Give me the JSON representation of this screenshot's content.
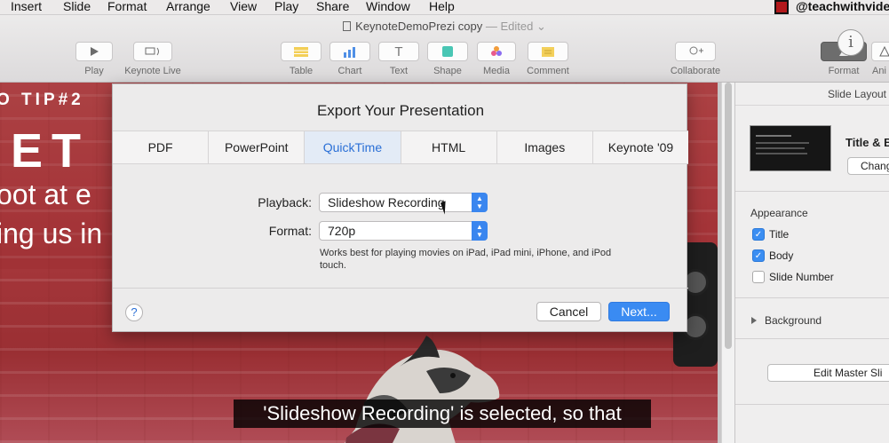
{
  "menubar": {
    "items": [
      "Insert",
      "Slide",
      "Format",
      "Arrange",
      "View",
      "Play",
      "Share",
      "Window",
      "Help"
    ],
    "account_handle": "@teachwithvide"
  },
  "window": {
    "doc_title": "KeynoteDemoPrezi copy",
    "edited_label": "— Edited ⌄"
  },
  "toolbar": {
    "buttons": [
      {
        "label": "Play",
        "icon": "play-icon"
      },
      {
        "label": "Keynote Live",
        "icon": "keynote-live-icon"
      },
      {
        "label": "Table",
        "icon": "table-icon"
      },
      {
        "label": "Chart",
        "icon": "chart-icon"
      },
      {
        "label": "Text",
        "icon": "text-icon"
      },
      {
        "label": "Shape",
        "icon": "shape-icon"
      },
      {
        "label": "Media",
        "icon": "media-icon"
      },
      {
        "label": "Comment",
        "icon": "comment-icon"
      },
      {
        "label": "Collaborate",
        "icon": "collaborate-icon"
      },
      {
        "label": "Format",
        "icon": "format-brush-icon"
      },
      {
        "label": "Ani",
        "icon": "animate-icon"
      }
    ],
    "info_glyph": "i"
  },
  "slide": {
    "tip_text": "O TIP#2",
    "big_text": "ET",
    "line1": "oot at e",
    "line2": "ing us in"
  },
  "inspector": {
    "header": "Slide Layout",
    "layout_name": "Title & B",
    "change_button": "Chang",
    "appearance_label": "Appearance",
    "checkboxes": [
      {
        "label": "Title",
        "checked": true
      },
      {
        "label": "Body",
        "checked": true
      },
      {
        "label": "Slide Number",
        "checked": false
      }
    ],
    "background_label": "Background",
    "edit_master_button": "Edit Master Sli"
  },
  "dialog": {
    "title": "Export Your Presentation",
    "tabs": [
      "PDF",
      "PowerPoint",
      "QuickTime",
      "HTML",
      "Images",
      "Keynote '09"
    ],
    "active_tab": "QuickTime",
    "playback_label": "Playback:",
    "playback_value": "Slideshow Recording",
    "format_label": "Format:",
    "format_value": "720p",
    "hint": "Works best for playing movies on iPad, iPad mini, iPhone, and iPod touch.",
    "help_glyph": "?",
    "cancel_label": "Cancel",
    "next_label": "Next..."
  },
  "caption": "'Slideshow Recording' is selected, so that",
  "colors": {
    "accent": "#3a8bf2",
    "active_tab_text": "#2a6fd6",
    "slide_brick": "#a9393d"
  }
}
